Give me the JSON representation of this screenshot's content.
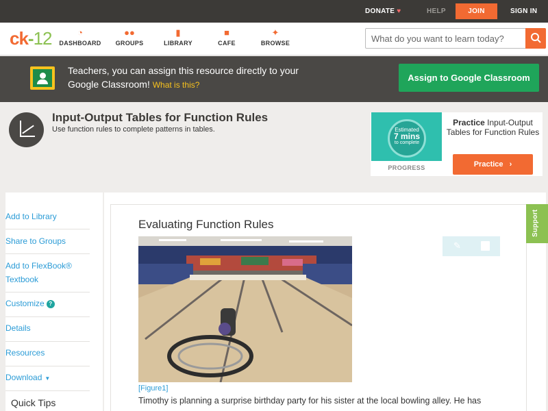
{
  "topbar": {
    "donate_label": "DONATE",
    "help_label": "HELP",
    "join_label": "JOIN",
    "signin_label": "SIGN IN"
  },
  "nav": {
    "logo": {
      "ck": "ck",
      "dash": "-",
      "num": "12"
    },
    "items": [
      {
        "label": "DASHBOARD",
        "icon": "dashboard-icon"
      },
      {
        "label": "GROUPS",
        "icon": "groups-icon"
      },
      {
        "label": "LIBRARY",
        "icon": "library-icon"
      },
      {
        "label": "CAFE",
        "icon": "cafe-icon"
      },
      {
        "label": "BROWSE",
        "icon": "browse-icon"
      }
    ],
    "search_placeholder": "What do you want to learn today?"
  },
  "teacher_banner": {
    "text": "Teachers, you can assign this resource directly to your Google Classroom!",
    "what_is_this": "What is this?",
    "assign_button": "Assign to Google Classroom"
  },
  "header": {
    "title": "Input-Output Tables for Function Rules",
    "subtitle": "Use function rules to complete patterns in tables."
  },
  "practice": {
    "estimated_line1": "Estimated",
    "estimated_line2": "7 mins",
    "estimated_line3": "to complete",
    "progress_label": "PROGRESS",
    "practice_bold": "Practice",
    "practice_topic": "Input-Output Tables for Function Rules",
    "practice_button": "Practice"
  },
  "sidebar": {
    "items": [
      {
        "label": "Add to Library"
      },
      {
        "label": "Share to Groups"
      },
      {
        "label": "Add to FlexBook® Textbook"
      },
      {
        "label": "Customize"
      },
      {
        "label": "Details"
      },
      {
        "label": "Resources"
      },
      {
        "label": "Download"
      }
    ],
    "quick_tips": "Quick Tips"
  },
  "content": {
    "section_title": "Evaluating Function Rules",
    "figure_caption": "[Figure1]",
    "body": "Timothy is planning a surprise birthday party for his sister at the local bowling alley. He has"
  },
  "support_label": "Support",
  "colors": {
    "accent_orange": "#f26a32",
    "brand_green": "#8cc152",
    "classroom_green": "#1fa55a",
    "link_blue": "#2a9bd6",
    "teal": "#2fbfae"
  }
}
